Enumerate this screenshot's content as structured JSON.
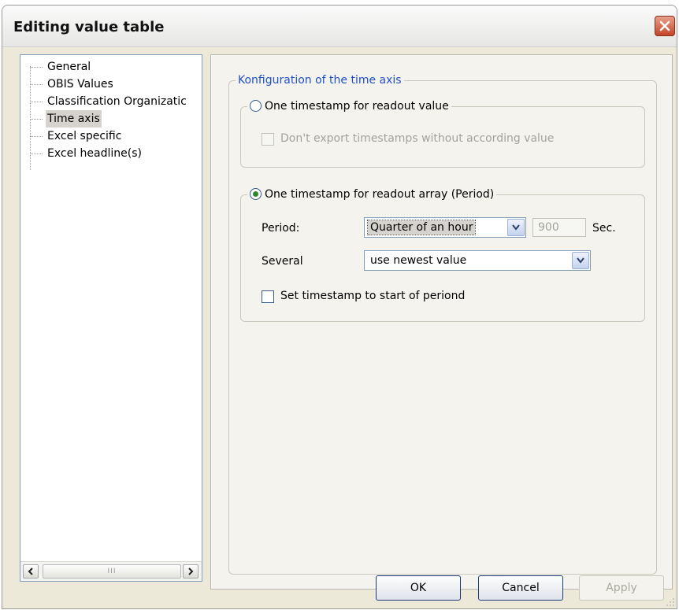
{
  "window": {
    "title": "Editing value table"
  },
  "tree": {
    "items": [
      {
        "label": "General",
        "selected": false
      },
      {
        "label": "OBIS Values",
        "selected": false
      },
      {
        "label": "Classification Organizatic",
        "selected": false
      },
      {
        "label": "Time axis",
        "selected": true
      },
      {
        "label": "Excel specific",
        "selected": false
      },
      {
        "label": "Excel headline(s)",
        "selected": false
      }
    ],
    "scroll_thumb_grip": "III"
  },
  "time_axis": {
    "group_title": "Konfiguration of the time axis",
    "option_value": {
      "label": "One timestamp for readout value",
      "selected": false,
      "dont_export_label": "Don't export timestamps without according value",
      "dont_export_checked": false,
      "enabled": false
    },
    "option_array": {
      "label": "One timestamp for readout array (Period)",
      "selected": true,
      "period_label": "Period:",
      "period_value": "Quarter of an hour",
      "seconds_value": "900",
      "seconds_unit": "Sec.",
      "several_label": "Several",
      "several_value": "use newest value",
      "set_start_label": "Set timestamp to start of periond",
      "set_start_checked": false
    }
  },
  "buttons": {
    "ok": "OK",
    "cancel": "Cancel",
    "apply": "Apply"
  },
  "colors": {
    "accent": "#2050c8",
    "dialog_bg": "#ece9d8",
    "close_red": "#c4452a"
  }
}
